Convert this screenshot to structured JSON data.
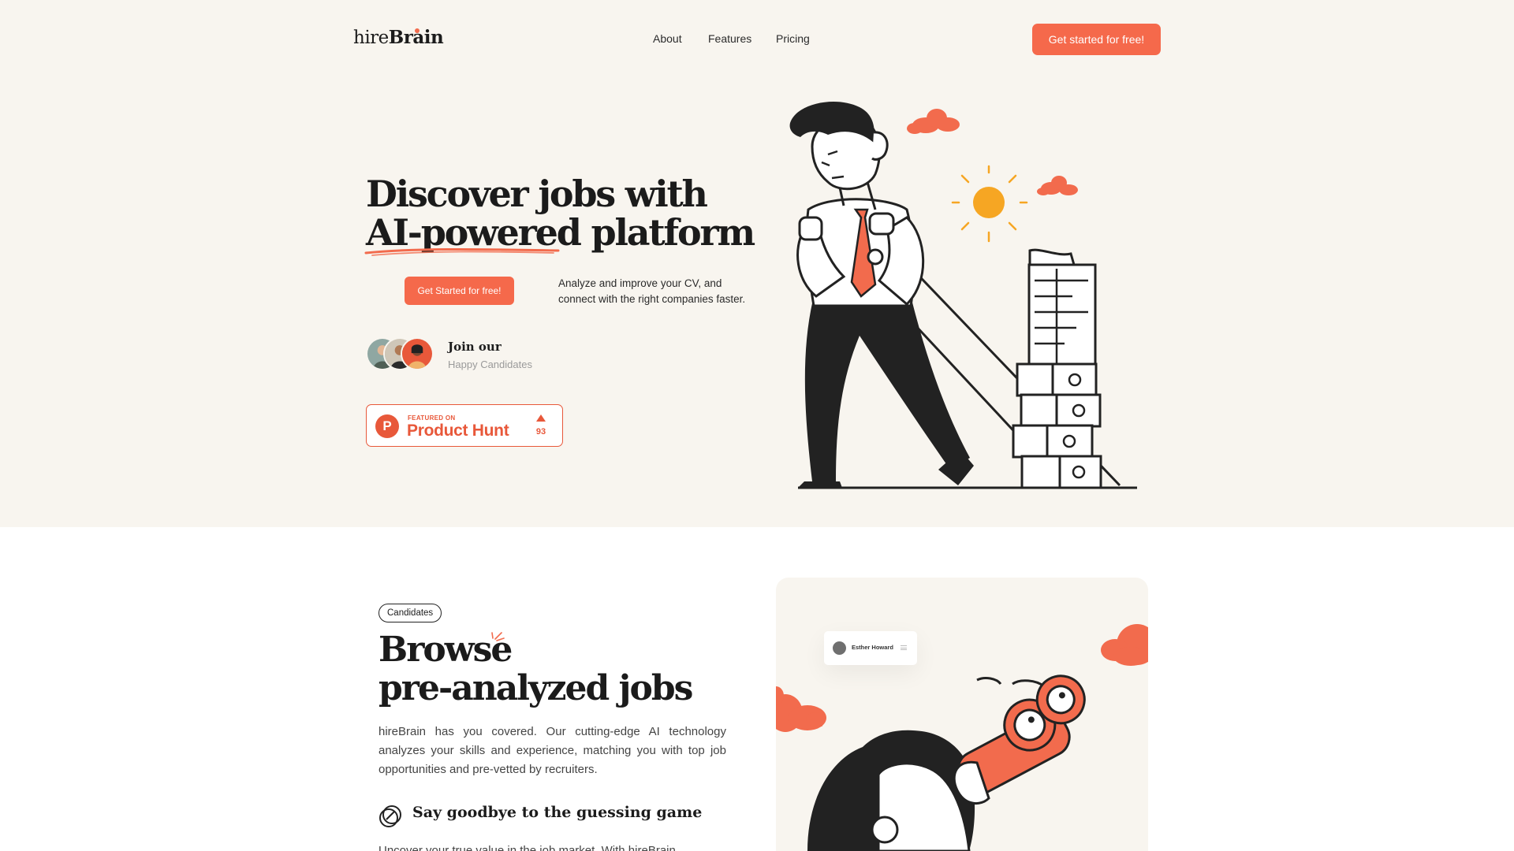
{
  "nav": {
    "logo_light": "hire",
    "logo_bold": "Brain",
    "links": [
      "About",
      "Features",
      "Pricing"
    ],
    "cta_label": "Get started for free!"
  },
  "hero": {
    "title_line1": "Discover jobs with",
    "title_line2": "AI-powered platform",
    "cta_label": "Get Started for free!",
    "description": "Analyze and improve your CV, and connect with the right companies faster.",
    "join_title": "Join our",
    "join_subtitle": "Happy Candidates",
    "product_hunt": {
      "featured_on": "FEATURED ON",
      "name": "Product Hunt",
      "logo_letter": "P",
      "upvotes": "93"
    }
  },
  "candidates": {
    "tag": "Candidates",
    "title_line1": "Browse",
    "title_line2": "pre-analyzed jobs",
    "description": "hireBrain has you covered. Our cutting-edge AI technology analyzes your skills and experience, matching you with top job opportunities and pre-vetted by recruiters.",
    "feature_title": "Say goodbye to the guessing game",
    "feature_text": "Uncover your true value in the job market. With hireBrain",
    "card_user_name": "Esther Howard"
  },
  "colors": {
    "accent": "#f5694b",
    "background": "#f8f5ef",
    "ink": "#1b1b1b",
    "sun": "#f6a623"
  }
}
